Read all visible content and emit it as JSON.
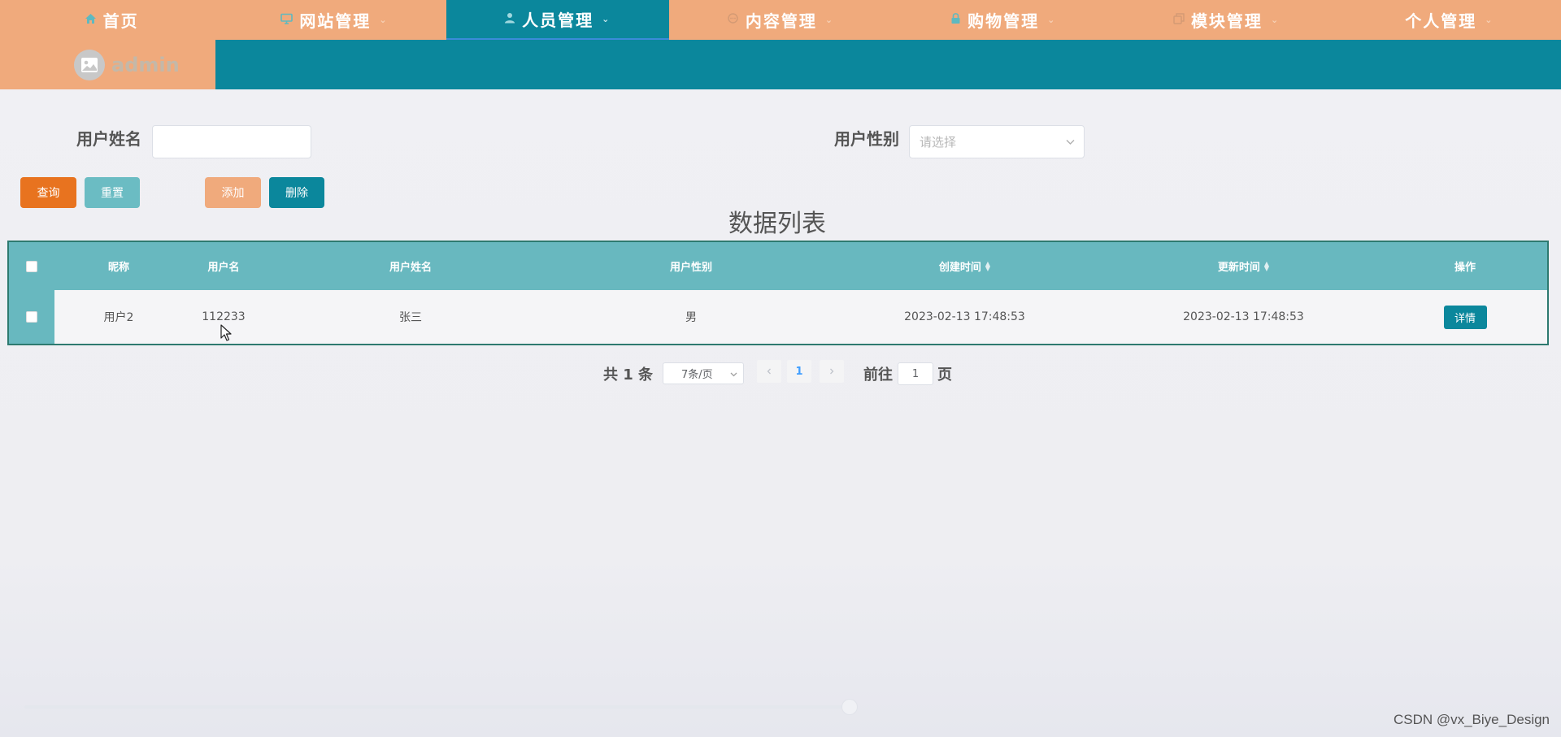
{
  "nav": {
    "items": [
      {
        "label": "首页",
        "icon": "home-icon",
        "active": false,
        "has_dropdown": false
      },
      {
        "label": "网站管理",
        "icon": "monitor-icon",
        "active": false,
        "has_dropdown": true
      },
      {
        "label": "人员管理",
        "icon": "user-icon",
        "active": true,
        "has_dropdown": true
      },
      {
        "label": "内容管理",
        "icon": "chat-icon",
        "active": false,
        "has_dropdown": true
      },
      {
        "label": "购物管理",
        "icon": "lock-icon",
        "active": false,
        "has_dropdown": true
      },
      {
        "label": "模块管理",
        "icon": "copy-icon",
        "active": false,
        "has_dropdown": true
      },
      {
        "label": "个人管理",
        "icon": "",
        "active": false,
        "has_dropdown": true
      }
    ]
  },
  "user": {
    "name": "admin"
  },
  "search": {
    "name_label": "用户姓名",
    "name_value": "",
    "gender_label": "用户性别",
    "gender_placeholder": "请选择"
  },
  "buttons": {
    "query": "查询",
    "reset": "重置",
    "add": "添加",
    "delete": "删除"
  },
  "table": {
    "title": "数据列表",
    "headers": [
      "昵称",
      "用户名",
      "用户姓名",
      "用户性别",
      "创建时间",
      "更新时间",
      "操作"
    ],
    "rows": [
      {
        "nickname": "用户2",
        "username": "112233",
        "realname": "张三",
        "gender": "男",
        "created": "2023-02-13 17:48:53",
        "updated": "2023-02-13 17:48:53",
        "action": "详情"
      }
    ]
  },
  "pagination": {
    "total": "共 1 条",
    "page_size": "7条/页",
    "current_page": "1",
    "goto_label": "前往",
    "goto_value": "1",
    "page_suffix": "页"
  },
  "footer": {
    "watermark": "CSDN @vx_Biye_Design"
  },
  "colors": {
    "nav_bg": "#f0aa7c",
    "accent": "#0b879c",
    "table_header": "#68b8bf",
    "query_btn": "#e8731f",
    "reset_btn": "#6bbcc3",
    "add_btn": "#f0aa7c"
  }
}
